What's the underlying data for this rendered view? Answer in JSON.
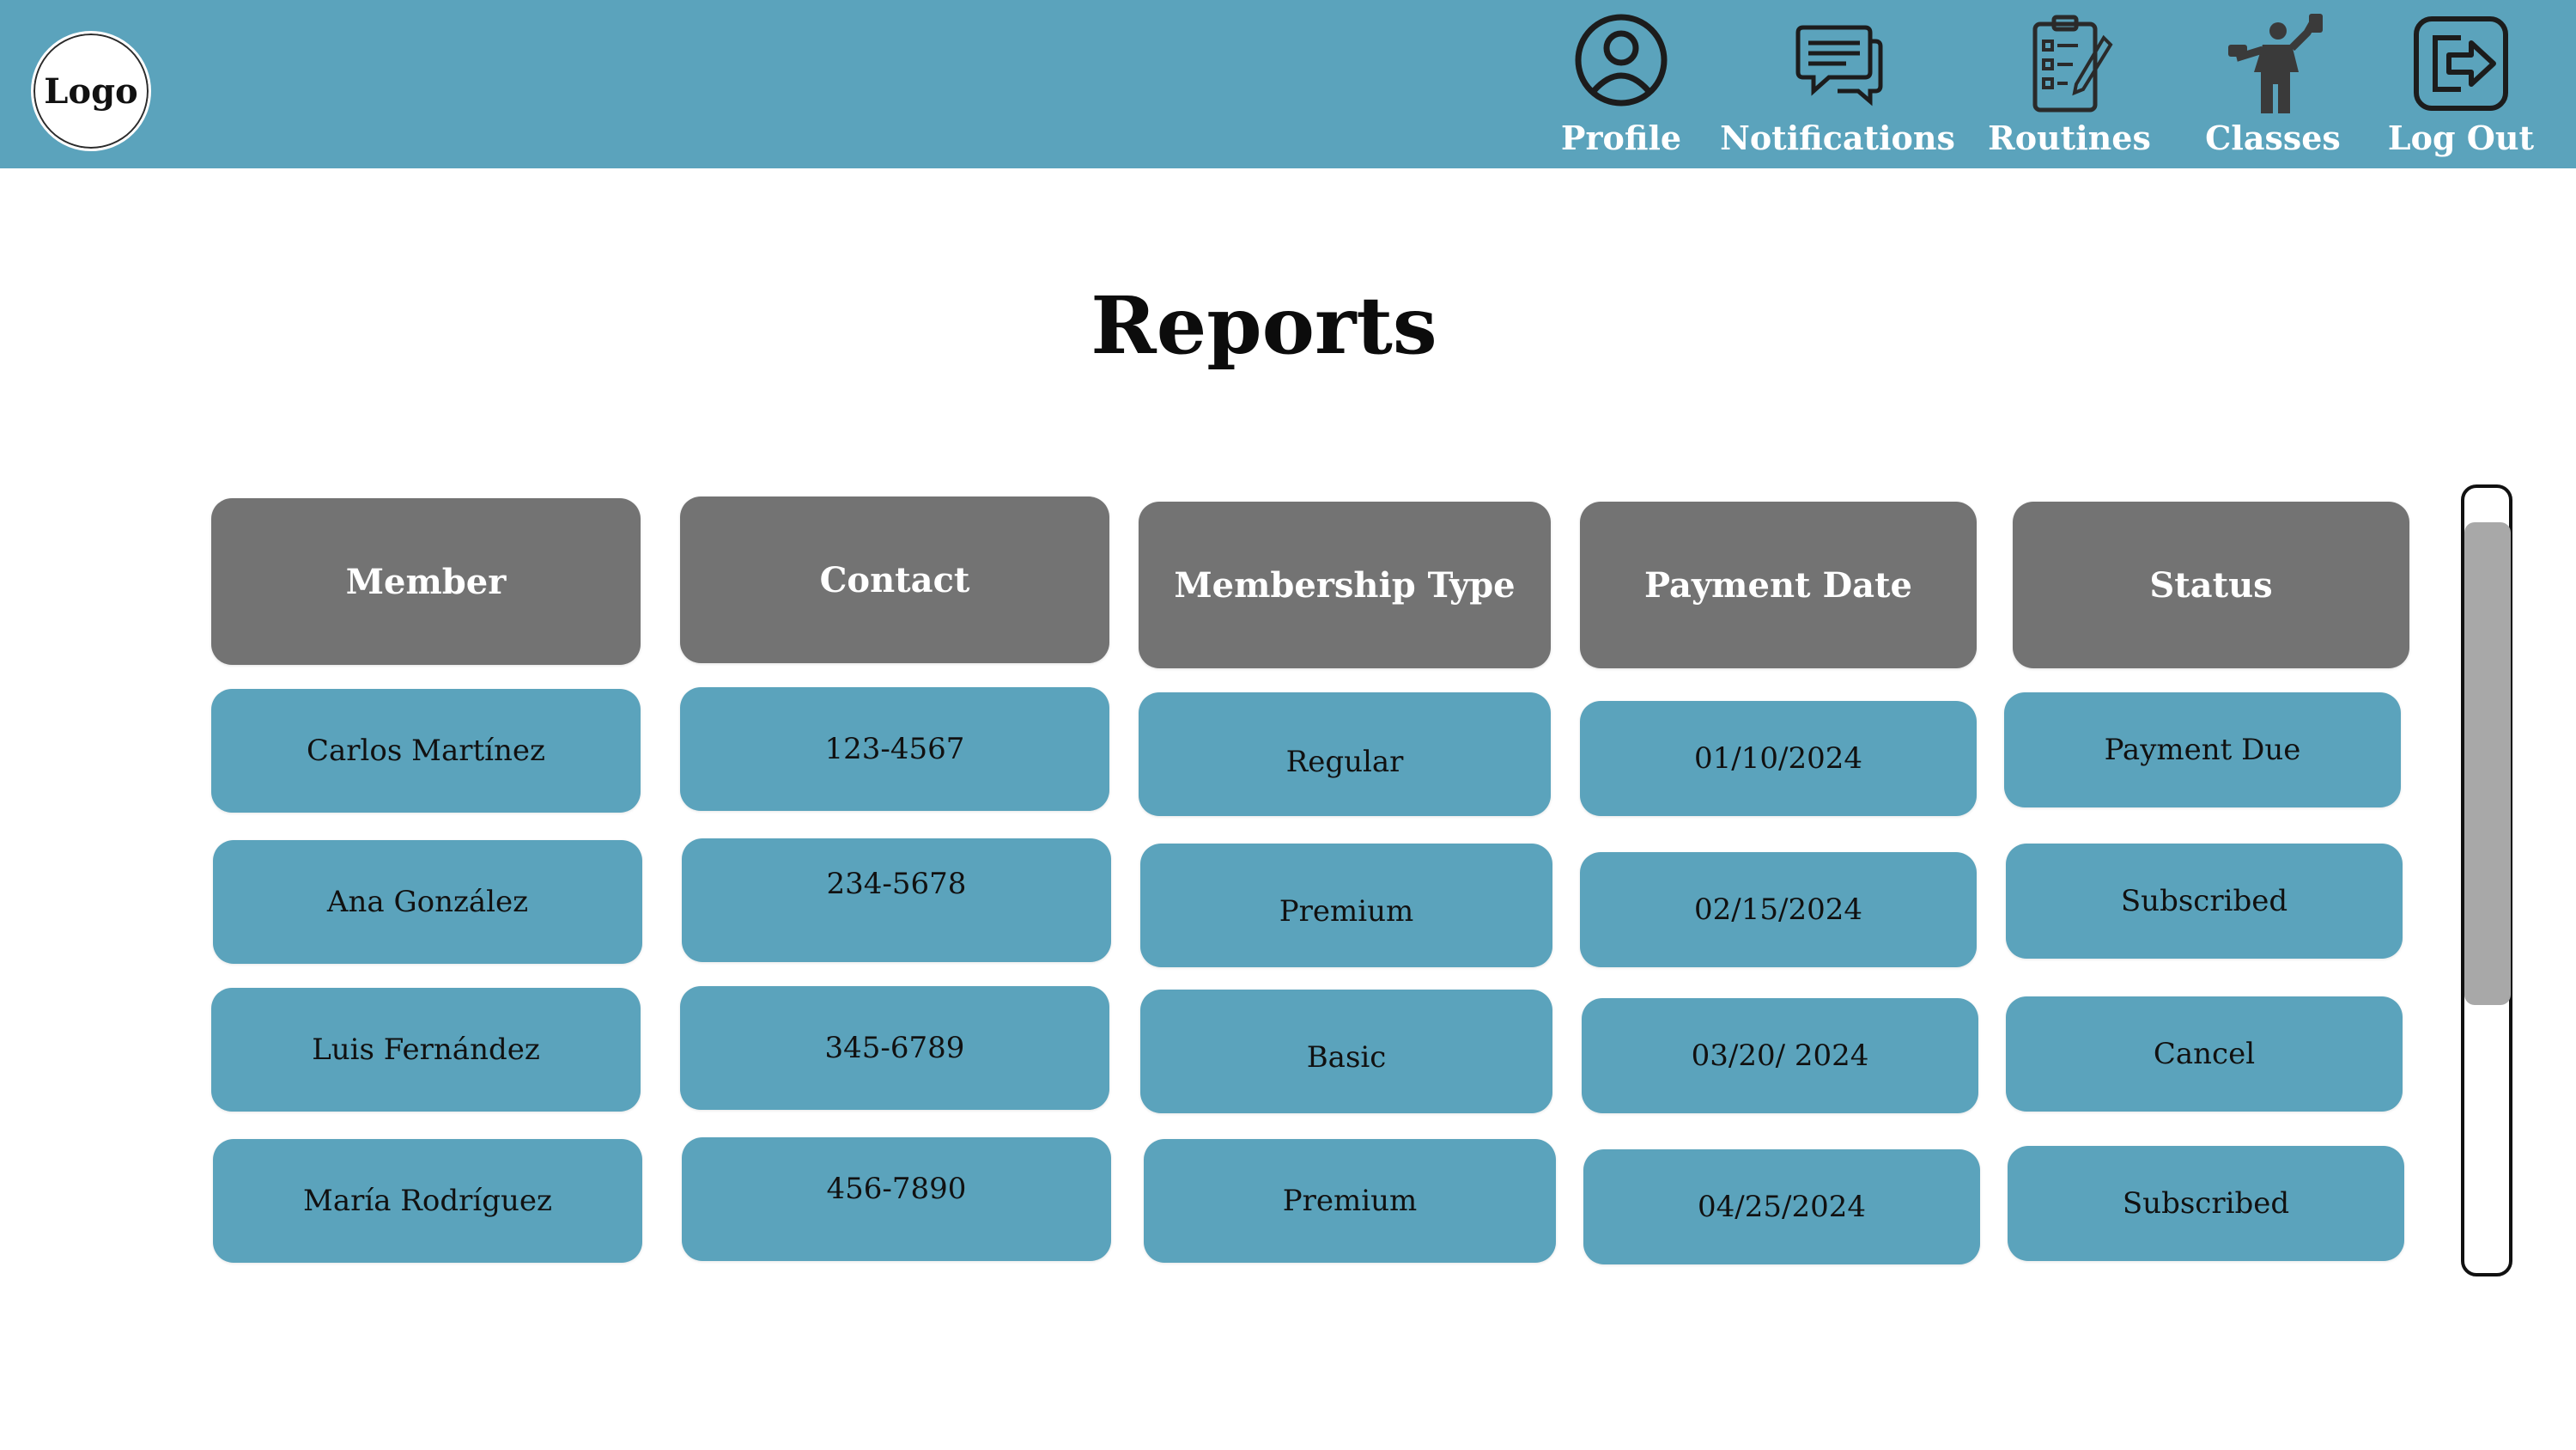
{
  "header": {
    "logo_text": "Logo",
    "nav": [
      {
        "label": "Profile",
        "icon": "profile-icon"
      },
      {
        "label": "Notifications",
        "icon": "notifications-icon"
      },
      {
        "label": "Routines",
        "icon": "routines-icon"
      },
      {
        "label": "Classes",
        "icon": "classes-icon"
      },
      {
        "label": "Log Out",
        "icon": "log-out-icon"
      }
    ]
  },
  "page": {
    "title": "Reports"
  },
  "table": {
    "columns": [
      "Member",
      "Contact",
      "Membership Type",
      "Payment Date",
      "Status"
    ],
    "rows": [
      [
        "Carlos Martínez",
        "123-4567",
        "Regular",
        "01/10/2024",
        "Payment Due"
      ],
      [
        "Ana González",
        "234-5678",
        "Premium",
        "02/15/2024",
        "Subscribed"
      ],
      [
        "Luis Fernández",
        "345-6789",
        "Basic",
        "03/20/ 2024",
        "Cancel"
      ],
      [
        "María Rodríguez",
        "456-7890",
        "Premium",
        "04/25/2024",
        "Subscribed"
      ]
    ]
  },
  "colors": {
    "header_bg": "#5ba3bc",
    "header_cell_bg": "#737373",
    "data_cell_bg": "#5ba3bc",
    "scroll_thumb": "#a8a8a8"
  }
}
